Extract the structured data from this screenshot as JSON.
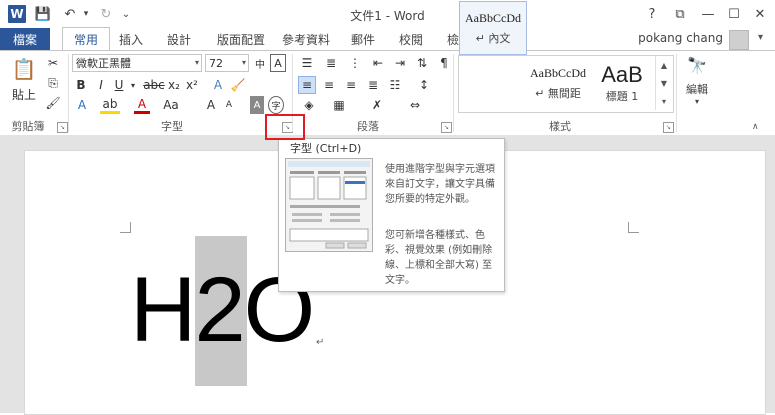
{
  "titlebar": {
    "title": "文件1 - Word",
    "help": "?",
    "restore": "⧉",
    "minimize": "—",
    "maximize": "☐",
    "close": "✕"
  },
  "quick_access": {
    "save": "💾",
    "undo": "↶",
    "redo": "↻",
    "customize": "⌄"
  },
  "tabs": {
    "file": "檔案",
    "items": [
      "常用",
      "插入",
      "設計",
      "版面配置",
      "參考資料",
      "郵件",
      "校閱",
      "檢視"
    ]
  },
  "user": {
    "name": "pokang chang"
  },
  "ribbon": {
    "clipboard": {
      "paste": "貼上",
      "label": "剪貼簿"
    },
    "font": {
      "font_name": "微軟正黑體",
      "font_size": "72",
      "label": "字型",
      "buttons": [
        "B",
        "I",
        "U",
        "abc",
        "x₂",
        "x²",
        "A",
        "A",
        "Aa",
        "A",
        "A"
      ]
    },
    "paragraph": {
      "label": "段落"
    },
    "styles": {
      "label": "樣式",
      "items": [
        {
          "sample": "AaBbCcDd",
          "name": "↵ 內文"
        },
        {
          "sample": "AaBbCcDd",
          "name": "↵ 無間距"
        },
        {
          "sample": "AaB",
          "name": "標題 1"
        }
      ]
    },
    "editing": {
      "label": "編輯"
    }
  },
  "document": {
    "text": "H2O",
    "para_mark": "↵"
  },
  "tooltip": {
    "title": "字型 (Ctrl+D)",
    "desc1": "使用進階字型與字元選項來自訂文字，讓文字具備您所要的特定外觀。",
    "desc2": "您可新增各種樣式、色彩、視覺效果 (例如刪除線、上標和全部大寫) 至文字。"
  },
  "colors": {
    "accent": "#2b579a",
    "highlight_box": "#e31b23"
  }
}
